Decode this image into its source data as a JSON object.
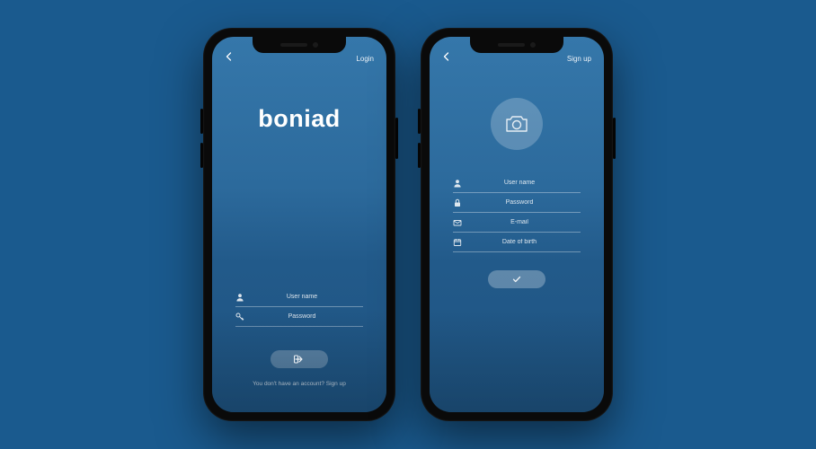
{
  "brand": "boniad",
  "login": {
    "header_link": "Login",
    "fields": {
      "username_placeholder": "User name",
      "password_placeholder": "Password"
    },
    "footnote_text": "You don't have an account? ",
    "footnote_action": "Sign up"
  },
  "signup": {
    "header_link": "Sign up",
    "fields": {
      "username_placeholder": "User name",
      "password_placeholder": "Password",
      "email_placeholder": "E-mail",
      "dob_placeholder": "Date of birth"
    }
  }
}
